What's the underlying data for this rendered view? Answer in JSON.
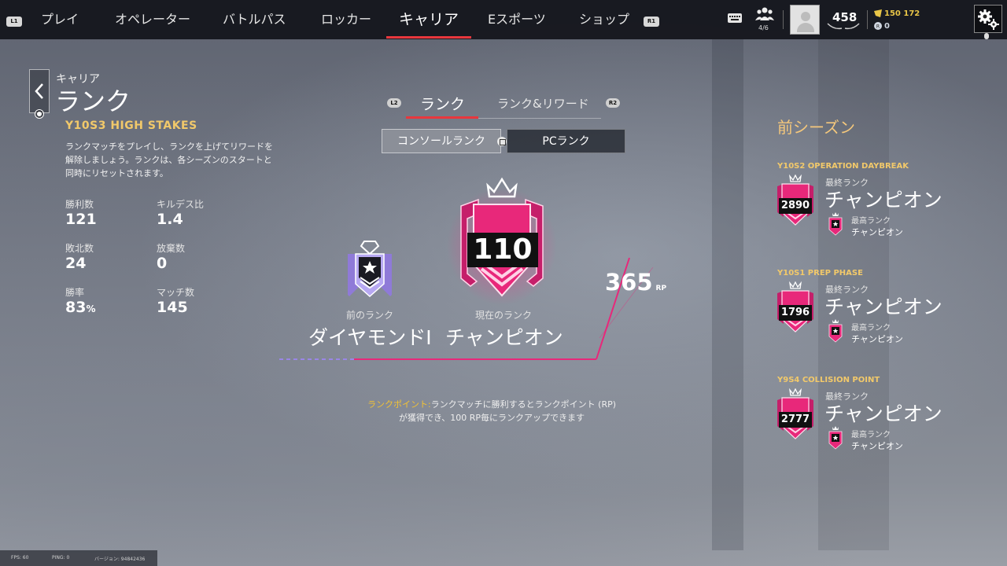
{
  "nav": {
    "l1": "L1",
    "r1": "R1",
    "items": [
      "プレイ",
      "オペレーター",
      "バトルパス",
      "ロッカー",
      "キャリア",
      "Eスポーツ",
      "ショップ"
    ],
    "active": "キャリア"
  },
  "topbar": {
    "squad": "4/6",
    "level": "458",
    "currency_renown": "150 172",
    "currency_credits": "0"
  },
  "left": {
    "breadcrumb": "キャリア",
    "title": "ランク",
    "season": "Y10S3 HIGH STAKES",
    "description": "ランクマッチをプレイし、ランクを上げてリワードを解除しましょう。ランクは、各シーズンのスタートと同時にリセットされます。",
    "stats": [
      {
        "label": "勝利数",
        "value": "121"
      },
      {
        "label": "キルデス比",
        "value": "1.4"
      },
      {
        "label": "敗北数",
        "value": "24"
      },
      {
        "label": "放棄数",
        "value": "0"
      },
      {
        "label": "勝率",
        "value": "83",
        "unit": "%"
      },
      {
        "label": "マッチ数",
        "value": "145"
      }
    ]
  },
  "center": {
    "l2": "L2",
    "r2": "R2",
    "tab_rank": "ランク",
    "tab_rewards": "ランク&リワード",
    "console_rank": "コンソールランク",
    "pc_rank": "PCランク",
    "current_number": "110",
    "previous_label": "前のランク",
    "previous_rank": "ダイヤモンドI",
    "current_label": "現在のランク",
    "current_rank": "チャンピオン",
    "rp_value": "365",
    "rp_unit": "RP",
    "hint_highlight": "ランクポイント:",
    "hint_text": "ランクマッチに勝利するとランクポイント (RP) が獲得でき、100 RP毎にランクアップできます"
  },
  "right": {
    "title": "前シーズン",
    "final_label": "最終ランク",
    "best_label": "最高ランク",
    "seasons": [
      {
        "name": "Y10S2 OPERATION DAYBREAK",
        "number": "2890",
        "final": "チャンピオン",
        "best": "チャンピオン"
      },
      {
        "name": "Y10S1 PREP PHASE",
        "number": "1796",
        "final": "チャンピオン",
        "best": "チャンピオン"
      },
      {
        "name": "Y9S4 COLLISION POINT",
        "number": "2777",
        "final": "チャンピオン",
        "best": "チャンピオン"
      }
    ]
  },
  "footer": {
    "fps": "FPS: 60",
    "ping": "PING: 0",
    "version": "バージョン: 94842436"
  },
  "colors": {
    "accent_red": "#e8373d",
    "champion_pink": "#e8287a",
    "gold": "#f2c96a",
    "diamond_purple": "#9a86e6"
  }
}
